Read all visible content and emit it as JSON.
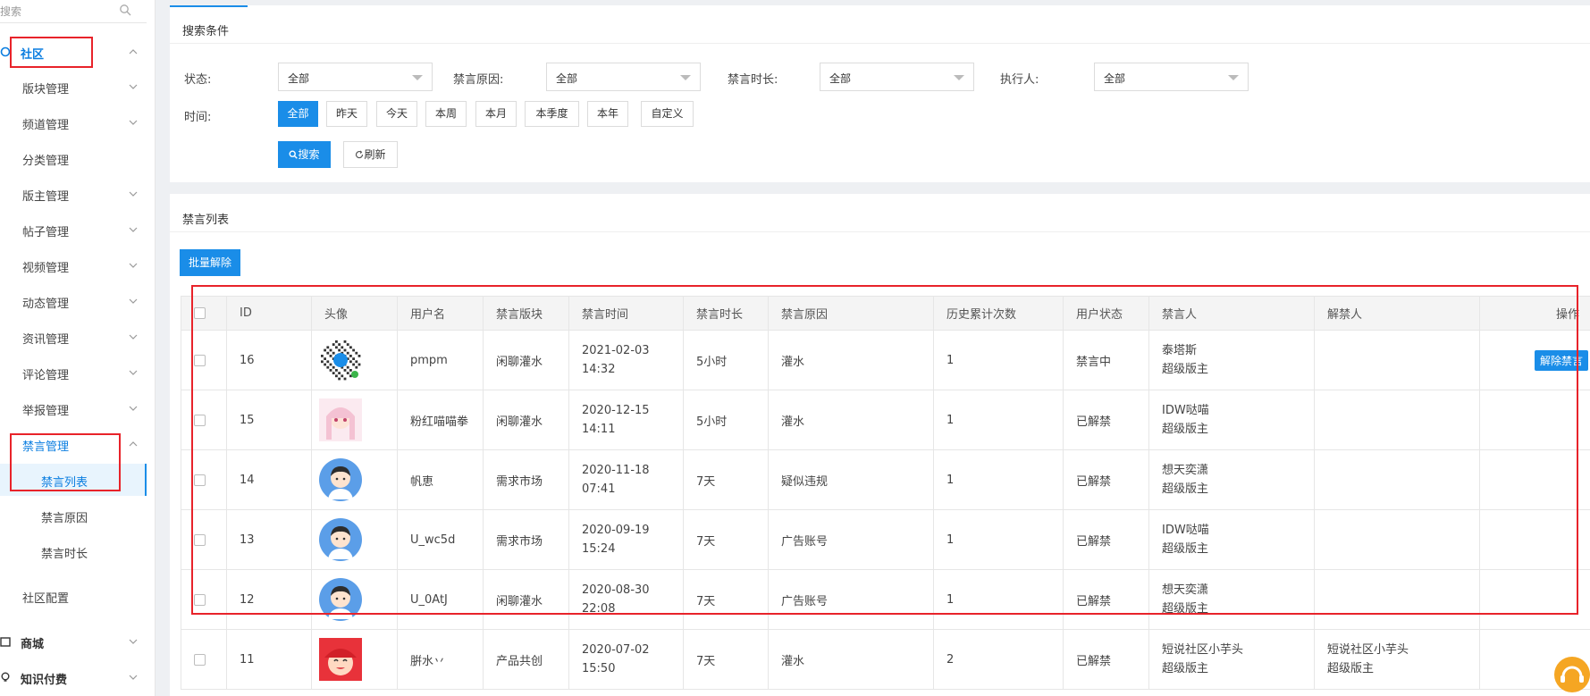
{
  "sidebar": {
    "search_placeholder": "搜索",
    "groups": [
      {
        "label": "社区"
      },
      {
        "label": "商城"
      },
      {
        "label": "知识付费"
      }
    ],
    "items": [
      {
        "label": "版块管理"
      },
      {
        "label": "频道管理"
      },
      {
        "label": "分类管理"
      },
      {
        "label": "版主管理"
      },
      {
        "label": "帖子管理"
      },
      {
        "label": "视频管理"
      },
      {
        "label": "动态管理"
      },
      {
        "label": "资讯管理"
      },
      {
        "label": "评论管理"
      },
      {
        "label": "举报管理"
      },
      {
        "label": "禁言管理"
      },
      {
        "label": "社区配置"
      }
    ],
    "subitems": [
      {
        "label": "禁言列表"
      },
      {
        "label": "禁言原因"
      },
      {
        "label": "禁言时长"
      }
    ]
  },
  "search_panel": {
    "title": "搜索条件",
    "filters": [
      {
        "label": "状态:",
        "value": "全部"
      },
      {
        "label": "禁言原因:",
        "value": "全部"
      },
      {
        "label": "禁言时长:",
        "value": "全部"
      },
      {
        "label": "执行人:",
        "value": "全部"
      }
    ],
    "time_label": "时间:",
    "time_options": [
      "全部",
      "昨天",
      "今天",
      "本周",
      "本月",
      "本季度",
      "本年",
      "自定义"
    ],
    "search_button": "搜索",
    "refresh_button": "刷新"
  },
  "list_panel": {
    "title": "禁言列表",
    "batch_button": "批量解除",
    "columns": [
      "ID",
      "头像",
      "用户名",
      "禁言版块",
      "禁言时间",
      "禁言时长",
      "禁言原因",
      "历史累计次数",
      "用户状态",
      "禁言人",
      "解禁人",
      "操作"
    ],
    "rows": [
      {
        "id": "16",
        "avatar": "qr-code-avatar",
        "username": "pmpm",
        "board": "闲聊灌水",
        "date": "2021-02-03",
        "time": "14:32",
        "duration": "5小时",
        "reason": "灌水",
        "count": "1",
        "status": "禁言中",
        "banner": "泰塔斯",
        "banner_role": "超级版主",
        "unbanner": "",
        "unbanner_role": "",
        "action": "解除禁言"
      },
      {
        "id": "15",
        "avatar": "anime-avatar",
        "username": "粉红喵喵拳",
        "board": "闲聊灌水",
        "date": "2020-12-15",
        "time": "14:11",
        "duration": "5小时",
        "reason": "灌水",
        "count": "1",
        "status": "已解禁",
        "banner": "IDW哒喵",
        "banner_role": "超级版主",
        "unbanner": "",
        "unbanner_role": "",
        "action": ""
      },
      {
        "id": "14",
        "avatar": "default-boy-avatar",
        "username": "帆恵",
        "board": "需求市场",
        "date": "2020-11-18",
        "time": "07:41",
        "duration": "7天",
        "reason": "疑似违规",
        "count": "1",
        "status": "已解禁",
        "banner": "想天奕潇",
        "banner_role": "超级版主",
        "unbanner": "",
        "unbanner_role": "",
        "action": ""
      },
      {
        "id": "13",
        "avatar": "default-boy-avatar",
        "username": "U_wc5d",
        "board": "需求市场",
        "date": "2020-09-19",
        "time": "15:24",
        "duration": "7天",
        "reason": "广告账号",
        "count": "1",
        "status": "已解禁",
        "banner": "IDW哒喵",
        "banner_role": "超级版主",
        "unbanner": "",
        "unbanner_role": "",
        "action": ""
      },
      {
        "id": "12",
        "avatar": "default-boy-avatar",
        "username": "U_0AtJ",
        "board": "闲聊灌水",
        "date": "2020-08-30",
        "time": "22:08",
        "duration": "7天",
        "reason": "广告账号",
        "count": "1",
        "status": "已解禁",
        "banner": "想天奕潇",
        "banner_role": "超级版主",
        "unbanner": "",
        "unbanner_role": "",
        "action": ""
      },
      {
        "id": "11",
        "avatar": "red-character-avatar",
        "username": "腁水丷",
        "board": "产品共创",
        "date": "2020-07-02",
        "time": "15:50",
        "duration": "7天",
        "reason": "灌水",
        "count": "2",
        "status": "已解禁",
        "banner": "短说社区小芋头",
        "banner_role": "超级版主",
        "unbanner": "短说社区小芋头",
        "unbanner_role": "超级版主",
        "action": ""
      }
    ]
  },
  "colors": {
    "accent": "#1a8de8",
    "highlight_box": "#e8232a"
  }
}
